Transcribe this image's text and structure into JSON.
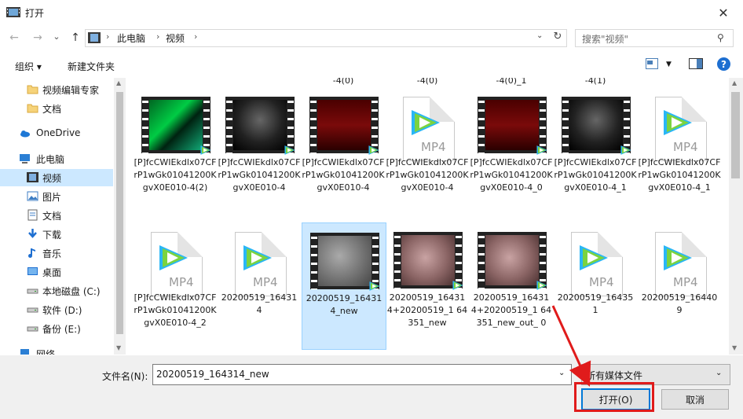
{
  "window": {
    "title": "打开",
    "close": "✕"
  },
  "nav": {
    "back": "←",
    "forward": "→",
    "recent": "⌄",
    "up": "↑",
    "crumbs": [
      "此电脑",
      "视频"
    ],
    "refresh": "↻",
    "search_placeholder": "搜索\"视频\""
  },
  "toolbar": {
    "organize": "组织 ▾",
    "new_folder": "新建文件夹",
    "help": "?"
  },
  "sidebar": {
    "items": [
      {
        "label": "视频编辑专家",
        "icon": "folder-icon",
        "level": 1
      },
      {
        "label": "文档",
        "icon": "folder-icon",
        "level": 1
      },
      {
        "label": "OneDrive",
        "icon": "cloud-icon",
        "level": 0
      },
      {
        "label": "此电脑",
        "icon": "computer-icon",
        "level": 0
      },
      {
        "label": "视频",
        "icon": "video-folder-icon",
        "level": 1,
        "selected": true
      },
      {
        "label": "图片",
        "icon": "pictures-icon",
        "level": 1
      },
      {
        "label": "文档",
        "icon": "documents-icon",
        "level": 1
      },
      {
        "label": "下载",
        "icon": "download-icon",
        "level": 1
      },
      {
        "label": "音乐",
        "icon": "music-icon",
        "level": 1
      },
      {
        "label": "桌面",
        "icon": "desktop-icon",
        "level": 1
      },
      {
        "label": "本地磁盘 (C:)",
        "icon": "drive-icon",
        "level": 1
      },
      {
        "label": "软件 (D:)",
        "icon": "drive-icon",
        "level": 1
      },
      {
        "label": "备份 (E:)",
        "icon": "drive-icon",
        "level": 1
      },
      {
        "label": "网络",
        "icon": "network-icon",
        "level": 0
      }
    ]
  },
  "prev_row_names": [
    "-4(0)",
    "-4(0)",
    "-4(0)_1",
    "-4(1)"
  ],
  "files": [
    {
      "name": "[P]fcCWIEkdlx07CFrP1wGk01041200KgvX0E010-4(2)",
      "thumb": "green"
    },
    {
      "name": "[P]fcCWIEkdlx07CFrP1wGk01041200KgvX0E010-4",
      "thumb": "dark"
    },
    {
      "name": "[P]fcCWIEkdlx07CFrP1wGk01041200KgvX0E010-4",
      "thumb": "red"
    },
    {
      "name": "[P]fcCWIEkdlx07CFrP1wGk01041200KgvX0E010-4",
      "thumb": "mp4"
    },
    {
      "name": "[P]fcCWIEkdlx07CFrP1wGk01041200KgvX0E010-4_0",
      "thumb": "red"
    },
    {
      "name": "[P]fcCWIEkdlx07CFrP1wGk01041200KgvX0E010-4_1",
      "thumb": "dark"
    },
    {
      "name": "[P]fcCWIEkdlx07CFrP1wGk01041200KgvX0E010-4_1",
      "thumb": "mp4"
    },
    {
      "name": "[P]fcCWIEkdlx07CFrP1wGk01041200KgvX0E010-4_2",
      "thumb": "mp4"
    },
    {
      "name": "20200519_16431 4",
      "thumb": "mp4"
    },
    {
      "name": "20200519_16431 4_new",
      "thumb": "gray",
      "selected": true
    },
    {
      "name": "20200519_16431 4+20200519_1 64351_new",
      "thumb": "pink"
    },
    {
      "name": "20200519_16431 4+20200519_1 64351_new_out_ 0",
      "thumb": "pink"
    },
    {
      "name": "20200519_16435 1",
      "thumb": "mp4"
    },
    {
      "name": "20200519_16440 9",
      "thumb": "mp4"
    }
  ],
  "bottom": {
    "filename_label": "文件名(N):",
    "filename_value": "20200519_164314_new",
    "file_type": "所有媒体文件",
    "open": "打开(O)",
    "cancel": "取消"
  },
  "mp4_label": "MP4",
  "colors": {
    "accent": "#0078d7",
    "selection": "#cce8ff",
    "highlight": "#e01b1b"
  }
}
